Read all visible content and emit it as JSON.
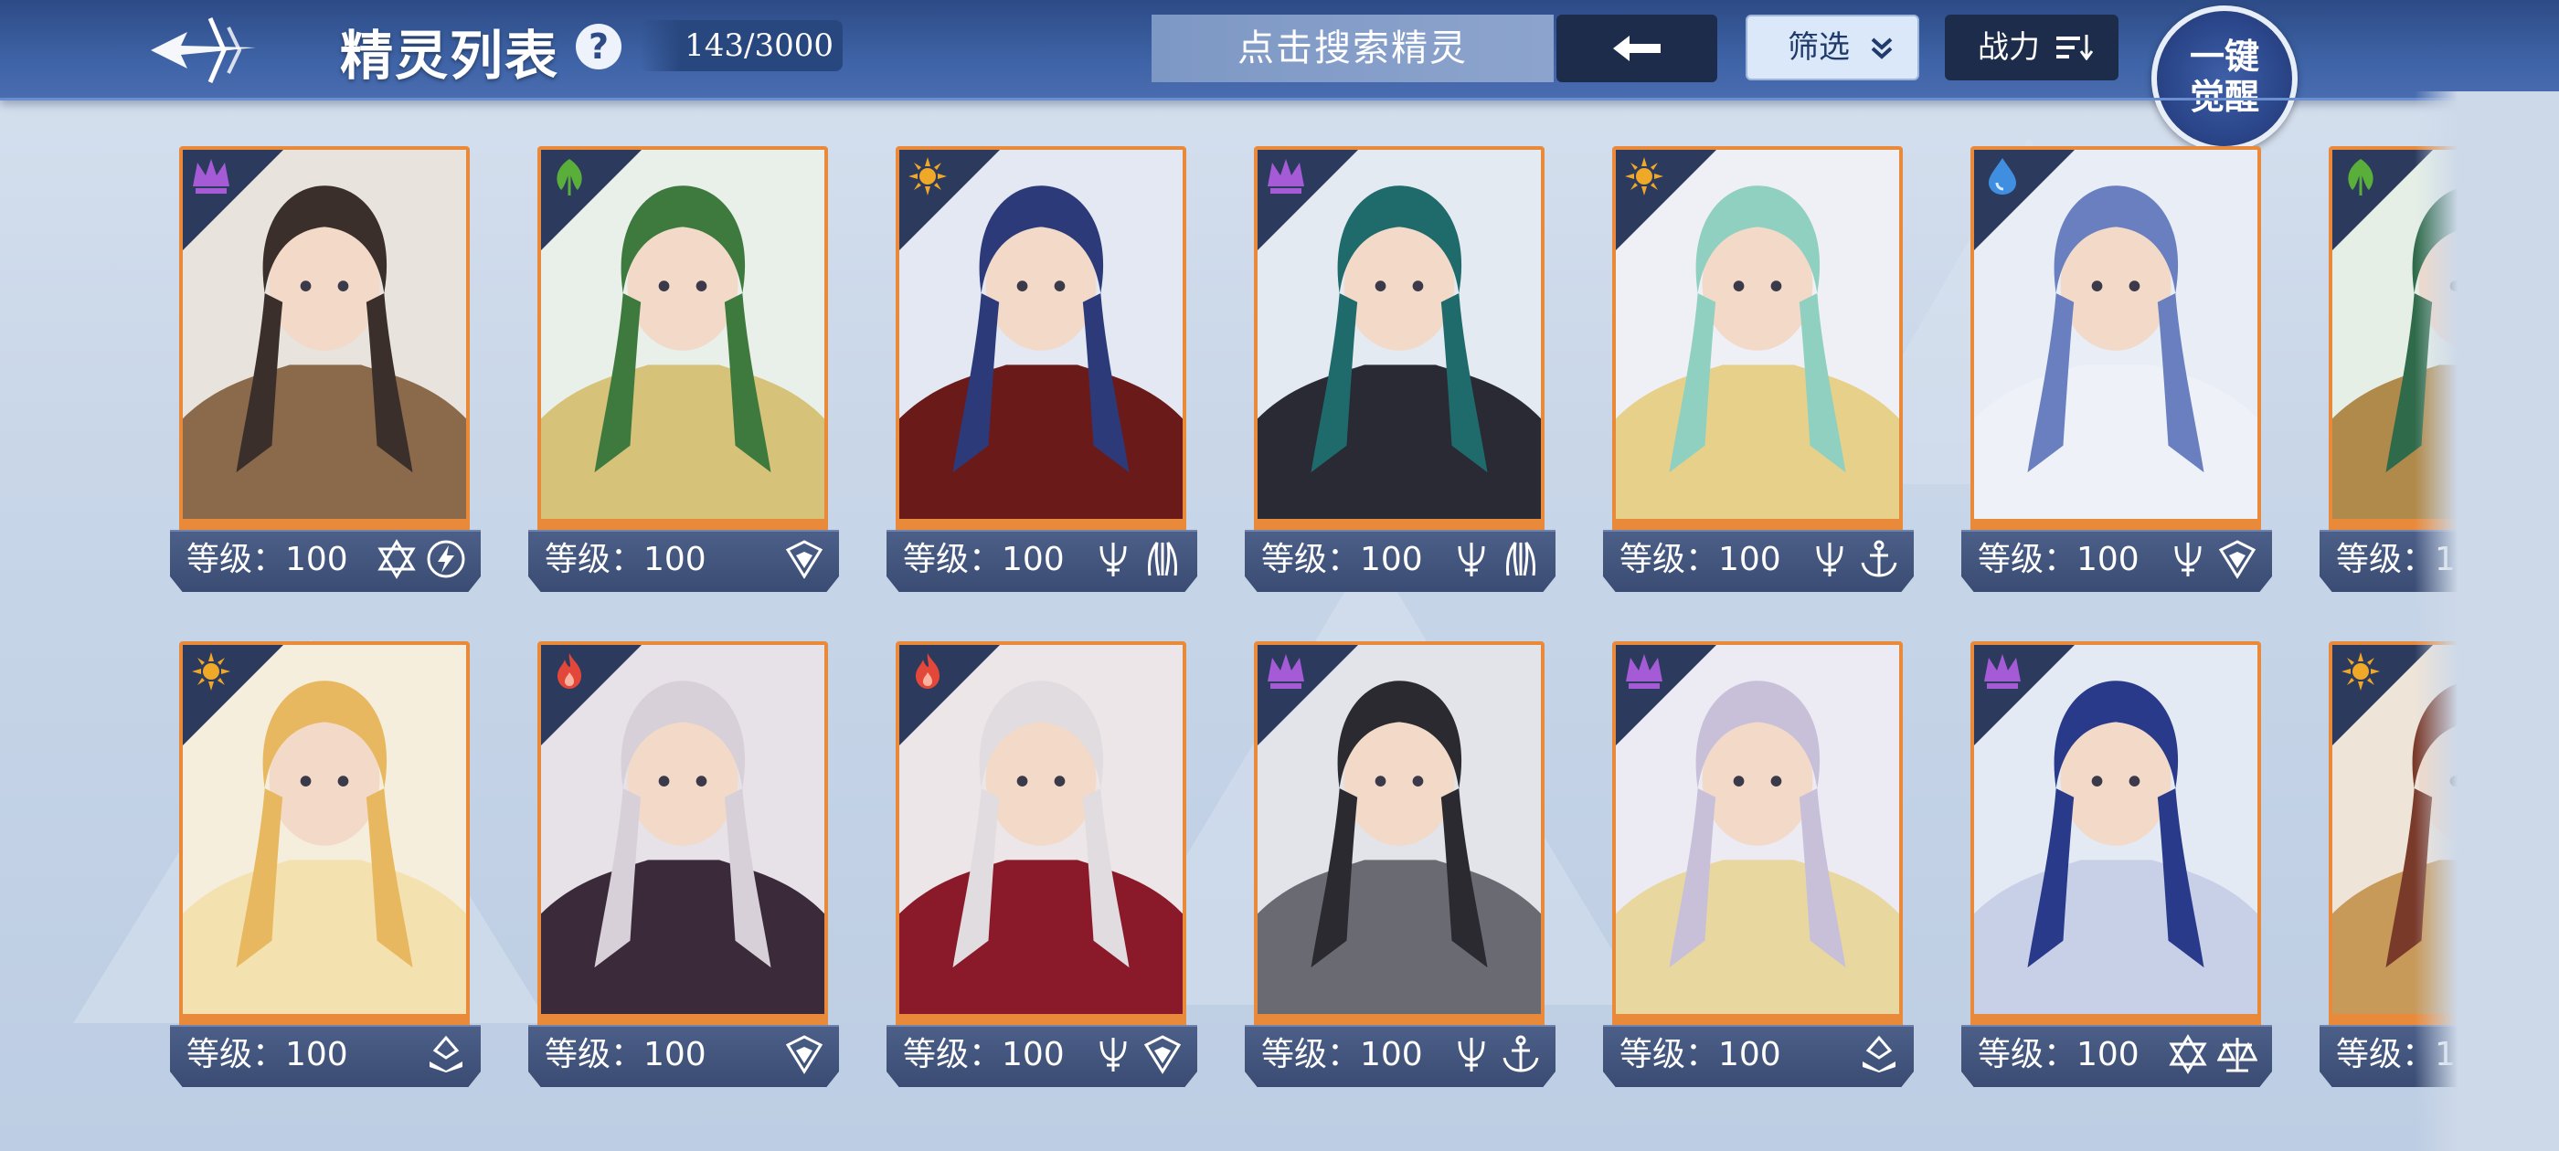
{
  "header": {
    "title": "精灵列表",
    "help_label": "?",
    "count": "143/3000",
    "search_placeholder": "点击搜索精灵",
    "filter_label": "筛选",
    "power_label": "战力",
    "awaken_line1": "一键",
    "awaken_line2": "觉醒"
  },
  "cards": [
    {
      "level": "等级：100",
      "element": "purple-crown",
      "icons": [
        "hexagram-icon",
        "lightning-icon"
      ]
    },
    {
      "level": "等级：100",
      "element": "green-leaf",
      "icons": [
        "shield-icon"
      ]
    },
    {
      "level": "等级：100",
      "element": "gold-sun",
      "icons": [
        "trident-icon",
        "claw-icon"
      ]
    },
    {
      "level": "等级：100",
      "element": "purple-crown",
      "icons": [
        "trident-icon",
        "claw-icon"
      ]
    },
    {
      "level": "等级：100",
      "element": "gold-sun",
      "icons": [
        "trident-icon",
        "anchor-icon"
      ]
    },
    {
      "level": "等级：100",
      "element": "blue-water",
      "icons": [
        "trident-icon",
        "shield-icon"
      ]
    },
    {
      "level": "等级：1",
      "element": "green-leaf",
      "icons": []
    },
    {
      "level": "等级：100",
      "element": "gold-sun",
      "icons": [
        "book-icon"
      ]
    },
    {
      "level": "等级：100",
      "element": "red-fire",
      "icons": [
        "shield-icon"
      ]
    },
    {
      "level": "等级：100",
      "element": "red-fire",
      "icons": [
        "trident-icon",
        "shield-icon"
      ]
    },
    {
      "level": "等级：100",
      "element": "purple-crown",
      "icons": [
        "trident-icon",
        "anchor-icon"
      ]
    },
    {
      "level": "等级：100",
      "element": "purple-crown",
      "icons": [
        "book-icon"
      ]
    },
    {
      "level": "等级：100",
      "element": "purple-crown",
      "icons": [
        "hexagram-icon",
        "scale-icon"
      ]
    },
    {
      "level": "等级：1",
      "element": "gold-sun",
      "icons": []
    }
  ],
  "colors": {
    "header": "#3e63a6",
    "card_border": "#e88a3a",
    "card_bar": "#3a4c73",
    "element_purple": "#a55ad6",
    "element_green": "#5aae3a",
    "element_gold": "#f0a828",
    "element_red": "#e2473a",
    "element_blue": "#3f8ee0"
  }
}
